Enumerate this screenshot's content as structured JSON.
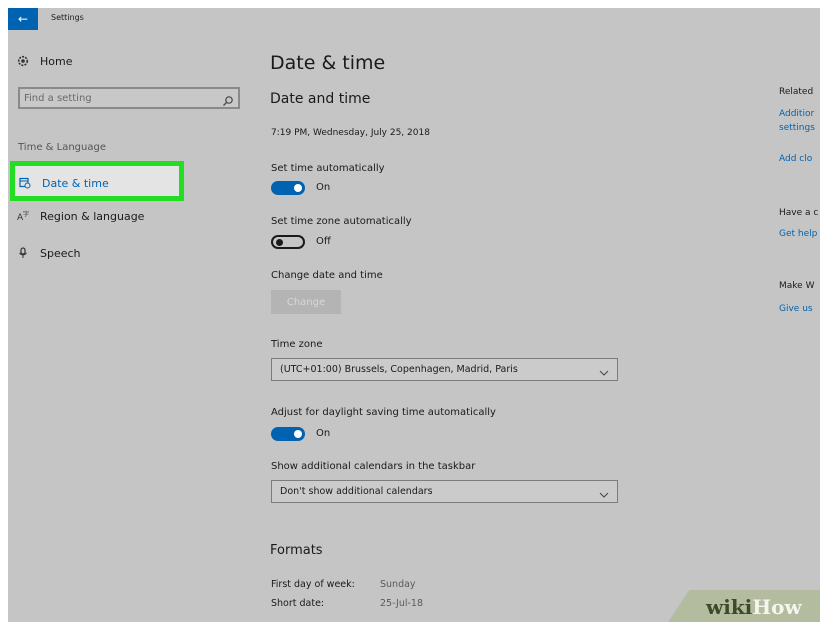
{
  "window": {
    "title": "Settings",
    "back_glyph": "←"
  },
  "sidebar": {
    "home_label": "Home",
    "search_placeholder": "Find a setting",
    "section_label": "Time & Language",
    "items": [
      {
        "label": "Date & time",
        "icon": "calendar-clock-icon",
        "active": true
      },
      {
        "label": "Region & language",
        "icon": "region-language-icon",
        "active": false
      },
      {
        "label": "Speech",
        "icon": "microphone-icon",
        "active": false
      }
    ],
    "highlight_color": "#22dd22"
  },
  "main": {
    "page_title": "Date & time",
    "section_title": "Date and time",
    "current_datetime": "7:19 PM, Wednesday, July 25, 2018",
    "set_time_auto": {
      "label": "Set time automatically",
      "state": "On"
    },
    "set_timezone_auto": {
      "label": "Set time zone automatically",
      "state": "Off"
    },
    "change_datetime": {
      "label": "Change date and time",
      "button": "Change"
    },
    "time_zone": {
      "label": "Time zone",
      "value": "(UTC+01:00) Brussels, Copenhagen, Madrid, Paris"
    },
    "daylight_saving": {
      "label": "Adjust for daylight saving time automatically",
      "state": "On"
    },
    "additional_calendars": {
      "label": "Show additional calendars in the taskbar",
      "value": "Don't show additional calendars"
    },
    "formats": {
      "heading": "Formats",
      "rows": [
        {
          "key": "First day of week:",
          "value": "Sunday"
        },
        {
          "key": "Short date:",
          "value": "25-Jul-18"
        }
      ]
    }
  },
  "related": {
    "heading": "Related",
    "link1_line1": "Additior",
    "link1_line2": "settings",
    "link2": "Add clo",
    "help_heading": "Have a c",
    "help_link": "Get help",
    "feedback_heading": "Make W",
    "feedback_link": "Give us"
  },
  "watermark": {
    "part1": "wiki",
    "part2": "How"
  },
  "colors": {
    "accent": "#0063b1",
    "background": "#c5c5c5"
  }
}
